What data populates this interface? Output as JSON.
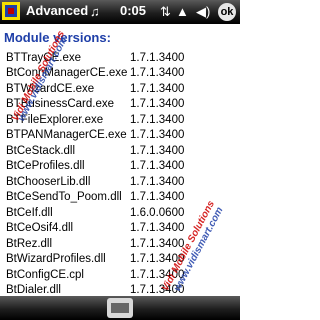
{
  "titlebar": {
    "title": "Advanced",
    "clock": "0:05",
    "ok_label": "ok"
  },
  "heading": "Module versions:",
  "modules": [
    {
      "name": "BTTrayCE.exe",
      "version": "1.7.1.3400"
    },
    {
      "name": "BtConnManagerCE.exe",
      "version": "1.7.1.3400"
    },
    {
      "name": "BTWizardCE.exe",
      "version": "1.7.1.3400"
    },
    {
      "name": "BTBusinessCard.exe",
      "version": "1.7.1.3400"
    },
    {
      "name": "BTFileExplorer.exe",
      "version": "1.7.1.3400"
    },
    {
      "name": "BTPANManagerCE.exe",
      "version": "1.7.1.3400"
    },
    {
      "name": "BtCeStack.dll",
      "version": "1.7.1.3400"
    },
    {
      "name": "BtCeProfiles.dll",
      "version": "1.7.1.3400"
    },
    {
      "name": "BtChooserLib.dll",
      "version": "1.7.1.3400"
    },
    {
      "name": "BtCeSendTo_Poom.dll",
      "version": "1.7.1.3400"
    },
    {
      "name": "BtCeIf.dll",
      "version": "1.6.0.0600"
    },
    {
      "name": "BtCeOsif4.dll",
      "version": "1.7.1.3400"
    },
    {
      "name": "BtRez.dll",
      "version": "1.7.1.3400"
    },
    {
      "name": "BtWizardProfiles.dll",
      "version": "1.7.1.3400"
    },
    {
      "name": "BtConfigCE.cpl",
      "version": "1.7.1.3400"
    },
    {
      "name": "BtDialer.dll",
      "version": "1.7.1.3400"
    }
  ],
  "watermarks": [
    "Vidi Mobile Solutions",
    "www.vidismart.com",
    "Vidi Mobile Solutions",
    "www.vidismart.com"
  ]
}
